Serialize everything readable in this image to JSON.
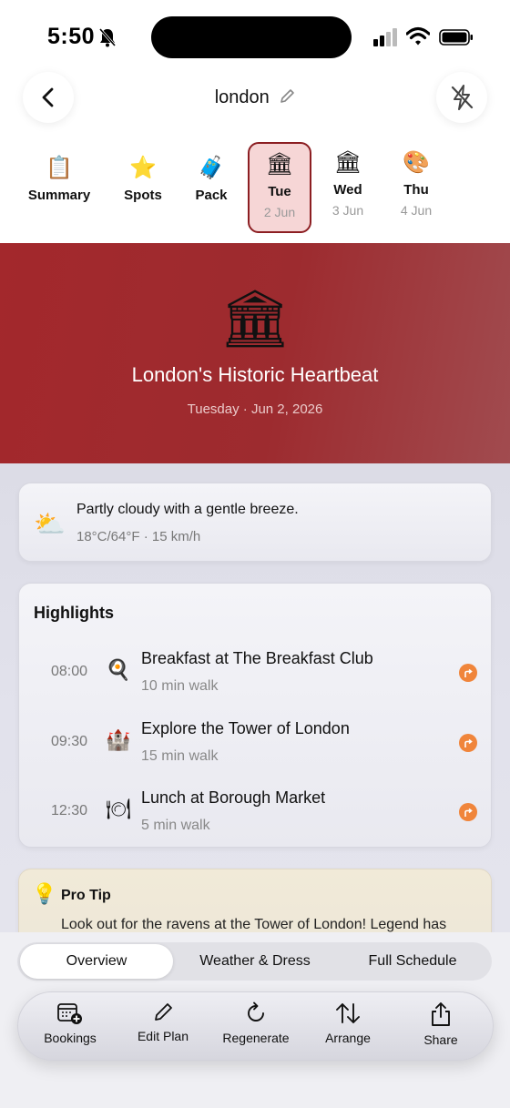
{
  "status": {
    "time": "5:50"
  },
  "header": {
    "title": "london"
  },
  "tabs": [
    {
      "emoji": "📋",
      "label": "Summary",
      "date": ""
    },
    {
      "emoji": "⭐",
      "label": "Spots",
      "date": ""
    },
    {
      "emoji": "🧳",
      "label": "Pack",
      "date": ""
    },
    {
      "emoji": "🏛",
      "label": "Tue",
      "date": "2 Jun"
    },
    {
      "emoji": "🏛",
      "label": "Wed",
      "date": "3 Jun"
    },
    {
      "emoji": "🎨",
      "label": "Thu",
      "date": "4 Jun"
    }
  ],
  "hero": {
    "emoji": "🏛",
    "title": "London's Historic Heartbeat",
    "weekday": "Tuesday",
    "date": "Jun 2, 2026"
  },
  "weather": {
    "emoji": "⛅",
    "description": "Partly cloudy with a gentle breeze.",
    "temperature": "18°C/64°F",
    "wind": "15 km/h"
  },
  "highlights": {
    "title": "Highlights",
    "items": [
      {
        "time": "08:00",
        "emoji": "🍳",
        "name": "Breakfast at The Breakfast Club",
        "walk": "10 min walk"
      },
      {
        "time": "09:30",
        "emoji": "🏰",
        "name": "Explore the Tower of London",
        "walk": "15 min walk"
      },
      {
        "time": "12:30",
        "emoji": "🍽",
        "name": "Lunch at Borough Market",
        "walk": "5 min walk"
      }
    ]
  },
  "tip": {
    "emoji": "💡",
    "title": "Pro Tip",
    "body": "Look out for the ravens at the Tower of London! Legend has"
  },
  "segments": [
    "Overview",
    "Weather & Dress",
    "Full Schedule"
  ],
  "toolbar": [
    "Bookings",
    "Edit Plan",
    "Regenerate",
    "Arrange",
    "Share"
  ],
  "colors": {
    "accent": "#9d2b2f",
    "route": "#f0853b",
    "tab_active_bg": "#f6d6d6"
  }
}
